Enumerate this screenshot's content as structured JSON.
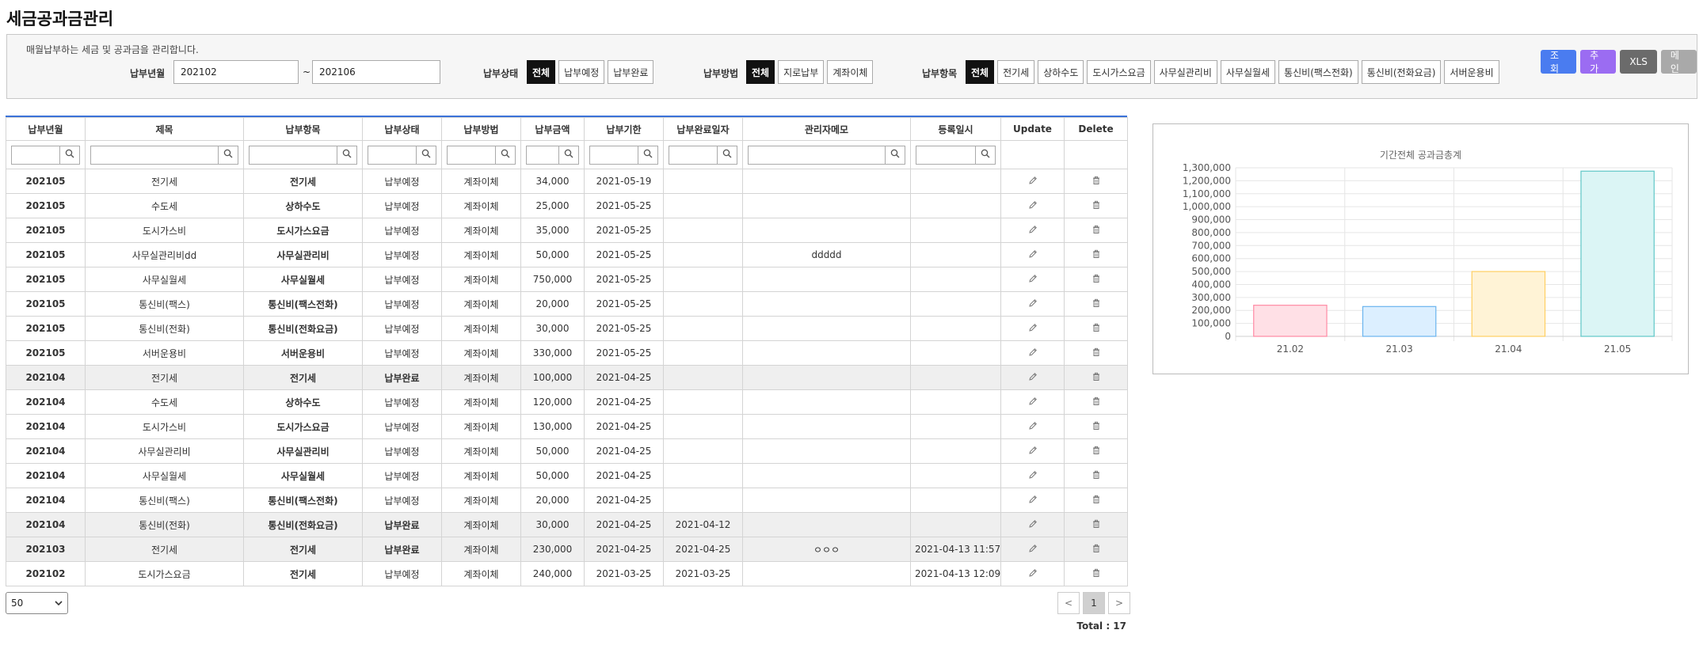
{
  "page": {
    "title": "세금공과금관리",
    "description": "매월납부하는 세금 및 공과금을 관리합니다."
  },
  "filters": {
    "period_label": "납부년월",
    "period_from": "202102",
    "period_sep": "~",
    "period_to": "202106",
    "status_label": "납부상태",
    "status_options": [
      "전체",
      "납부예정",
      "납부완료"
    ],
    "method_label": "납부방법",
    "method_options": [
      "전체",
      "지로납부",
      "계좌이체"
    ],
    "item_label": "납부항목",
    "item_options": [
      "전체",
      "전기세",
      "상하수도",
      "도시가스요금",
      "사무실관리비",
      "사무실월세",
      "통신비(팩스전화)",
      "통신비(전화요금)",
      "서버운용비"
    ]
  },
  "actions": {
    "search": "조회",
    "add": "추가",
    "xls": "XLS",
    "mail": "메인"
  },
  "colors": {
    "search": "#4a7cf0",
    "add": "#9b6cf2",
    "xls": "#6b6b6b",
    "mail": "#a9a9a9",
    "amount": "#e0331b",
    "accent": "#3b72d9"
  },
  "table": {
    "columns": [
      "납부년월",
      "제목",
      "납부항목",
      "납부상태",
      "납부방법",
      "납부금액",
      "납부기한",
      "납부완료일자",
      "관리자메모",
      "등록일시",
      "Update",
      "Delete"
    ],
    "rows": [
      {
        "ym": "202105",
        "title": "전기세",
        "item": "전기세",
        "status": "납부예정",
        "method": "계좌이체",
        "amount": "34,000",
        "due": "2021-05-19",
        "paid": "",
        "memo": "",
        "reg": ""
      },
      {
        "ym": "202105",
        "title": "수도세",
        "item": "상하수도",
        "status": "납부예정",
        "method": "계좌이체",
        "amount": "25,000",
        "due": "2021-05-25",
        "paid": "",
        "memo": "",
        "reg": ""
      },
      {
        "ym": "202105",
        "title": "도시가스비",
        "item": "도시가스요금",
        "status": "납부예정",
        "method": "계좌이체",
        "amount": "35,000",
        "due": "2021-05-25",
        "paid": "",
        "memo": "",
        "reg": ""
      },
      {
        "ym": "202105",
        "title": "사무실관리비dd",
        "item": "사무실관리비",
        "status": "납부예정",
        "method": "계좌이체",
        "amount": "50,000",
        "due": "2021-05-25",
        "paid": "",
        "memo": "ddddd",
        "reg": ""
      },
      {
        "ym": "202105",
        "title": "사무실월세",
        "item": "사무실월세",
        "status": "납부예정",
        "method": "계좌이체",
        "amount": "750,000",
        "due": "2021-05-25",
        "paid": "",
        "memo": "",
        "reg": ""
      },
      {
        "ym": "202105",
        "title": "통신비(팩스)",
        "item": "통신비(팩스전화)",
        "status": "납부예정",
        "method": "계좌이체",
        "amount": "20,000",
        "due": "2021-05-25",
        "paid": "",
        "memo": "",
        "reg": ""
      },
      {
        "ym": "202105",
        "title": "통신비(전화)",
        "item": "통신비(전화요금)",
        "status": "납부예정",
        "method": "계좌이체",
        "amount": "30,000",
        "due": "2021-05-25",
        "paid": "",
        "memo": "",
        "reg": ""
      },
      {
        "ym": "202105",
        "title": "서버운용비",
        "item": "서버운용비",
        "status": "납부예정",
        "method": "계좌이체",
        "amount": "330,000",
        "due": "2021-05-25",
        "paid": "",
        "memo": "",
        "reg": ""
      },
      {
        "ym": "202104",
        "title": "전기세",
        "item": "전기세",
        "status": "납부완료",
        "method": "계좌이체",
        "amount": "100,000",
        "due": "2021-04-25",
        "paid": "",
        "memo": "",
        "reg": ""
      },
      {
        "ym": "202104",
        "title": "수도세",
        "item": "상하수도",
        "status": "납부예정",
        "method": "계좌이체",
        "amount": "120,000",
        "due": "2021-04-25",
        "paid": "",
        "memo": "",
        "reg": ""
      },
      {
        "ym": "202104",
        "title": "도시가스비",
        "item": "도시가스요금",
        "status": "납부예정",
        "method": "계좌이체",
        "amount": "130,000",
        "due": "2021-04-25",
        "paid": "",
        "memo": "",
        "reg": ""
      },
      {
        "ym": "202104",
        "title": "사무실관리비",
        "item": "사무실관리비",
        "status": "납부예정",
        "method": "계좌이체",
        "amount": "50,000",
        "due": "2021-04-25",
        "paid": "",
        "memo": "",
        "reg": ""
      },
      {
        "ym": "202104",
        "title": "사무실월세",
        "item": "사무실월세",
        "status": "납부예정",
        "method": "계좌이체",
        "amount": "50,000",
        "due": "2021-04-25",
        "paid": "",
        "memo": "",
        "reg": ""
      },
      {
        "ym": "202104",
        "title": "통신비(팩스)",
        "item": "통신비(팩스전화)",
        "status": "납부예정",
        "method": "계좌이체",
        "amount": "20,000",
        "due": "2021-04-25",
        "paid": "",
        "memo": "",
        "reg": ""
      },
      {
        "ym": "202104",
        "title": "통신비(전화)",
        "item": "통신비(전화요금)",
        "status": "납부완료",
        "method": "계좌이체",
        "amount": "30,000",
        "due": "2021-04-25",
        "paid": "2021-04-12",
        "memo": "",
        "reg": ""
      },
      {
        "ym": "202103",
        "title": "전기세",
        "item": "전기세",
        "status": "납부완료",
        "method": "계좌이체",
        "amount": "230,000",
        "due": "2021-04-25",
        "paid": "2021-04-25",
        "memo": "ㅇㅇㅇ",
        "reg": "2021-04-13 11:57"
      },
      {
        "ym": "202102",
        "title": "도시가스요금",
        "item": "전기세",
        "status": "납부예정",
        "method": "계좌이체",
        "amount": "240,000",
        "due": "2021-03-25",
        "paid": "2021-03-25",
        "memo": "",
        "reg": "2021-04-13 12:09"
      }
    ]
  },
  "footer": {
    "page_size": "50",
    "pages": [
      "<",
      "1",
      ">"
    ],
    "total": "Total : 17"
  },
  "chart_data": {
    "type": "bar",
    "title": "기간전체 공과금총계",
    "categories": [
      "21.02",
      "21.03",
      "21.04",
      "21.05"
    ],
    "values": [
      240000,
      230000,
      500000,
      1274000
    ],
    "ylim": [
      0,
      1300000
    ],
    "yticks": [
      0,
      100000,
      200000,
      300000,
      400000,
      500000,
      600000,
      700000,
      800000,
      900000,
      1000000,
      1100000,
      1200000,
      1300000
    ],
    "colors": [
      {
        "fill": "#ffe0e6",
        "stroke": "#ff8aa4"
      },
      {
        "fill": "#dcefff",
        "stroke": "#6ab4ee"
      },
      {
        "fill": "#fff3d6",
        "stroke": "#ffcf62"
      },
      {
        "fill": "#dbf5f5",
        "stroke": "#5fc7c7"
      }
    ],
    "grid": true,
    "legend": "none"
  }
}
